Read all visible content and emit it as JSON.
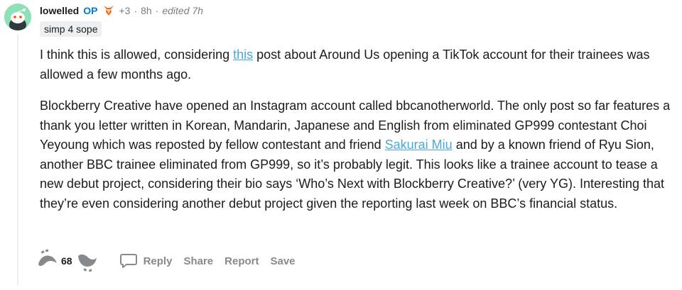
{
  "comment": {
    "username": "lowelled",
    "op_badge": "OP",
    "award_count": "+3",
    "time_ago": "8h",
    "edited": "edited 7h",
    "user_flair": "simp 4 sope",
    "paragraph1": {
      "before_link": "I think this is allowed, considering ",
      "link_text": "this",
      "after_link": " post about Around Us opening a TikTok account for their trainees was allowed a few months ago."
    },
    "paragraph2": {
      "before_link": "Blockberry Creative have opened an Instagram account called bbcanotherworld. The only post so far features a thank you letter written in Korean, Mandarin, Japanese and English from eliminated GP999 contestant Choi Yeyoung which was reposted by fellow contestant and friend ",
      "link_text": "Sakurai Miu",
      "after_link": " and by a known friend of Ryu Sion, another BBC trainee eliminated from GP999, so it’s probably legit. This looks like a trainee account to tease a new debut project, considering their bio says ‘Who’s Next with Blockberry Creative?’ (very YG). Interesting that they’re even considering another debut project given the reporting last week on BBC’s financial status."
    },
    "score": "68",
    "actions": {
      "reply": "Reply",
      "share": "Share",
      "report": "Report",
      "save": "Save"
    }
  },
  "colors": {
    "op_blue": "#0079d3",
    "link": "#4aa8d8",
    "avatar_bg": "#8de0b8",
    "muted": "#7c7c7c"
  },
  "icons": {
    "avatar": "snoo-avatar-icon",
    "flair": "fox-flair-icon",
    "upvote": "upvote-icon",
    "downvote": "downvote-icon",
    "reply": "comment-bubble-icon"
  }
}
